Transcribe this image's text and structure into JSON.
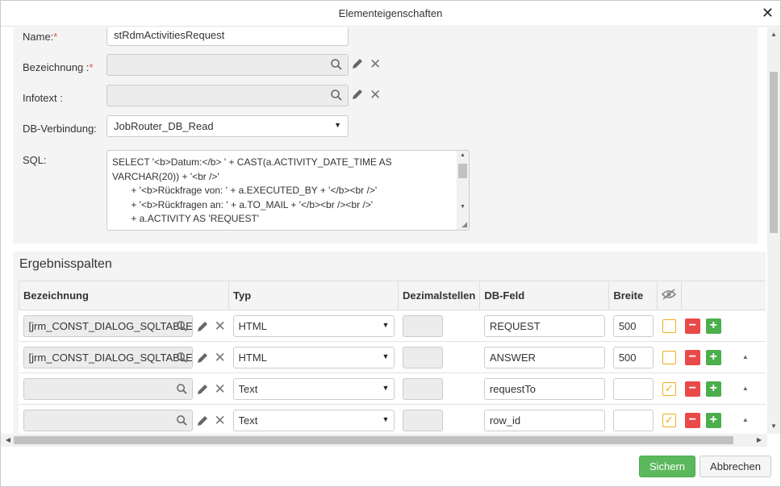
{
  "dialog": {
    "title": "Elementeigenschaften"
  },
  "form": {
    "name": {
      "label": "Name:",
      "value": "stRdmActivitiesRequest"
    },
    "bezeichnung": {
      "label": "Bezeichnung :",
      "value": ""
    },
    "infotext": {
      "label": "Infotext :",
      "value": ""
    },
    "db_verbindung": {
      "label": "DB-Verbindung:",
      "value": "JobRouter_DB_Read"
    },
    "sql": {
      "label": "SQL:",
      "value": "SELECT '<b>Datum:</b> ' + CAST(a.ACTIVITY_DATE_TIME AS VARCHAR(20)) + '<br />'\n       + '<b>Rückfrage von: ' + a.EXECUTED_BY + '</b><br />'\n       + '<b>Rückfragen an: ' + a.TO_MAIL + '</b><br /><br />'\n       + a.ACTIVITY AS 'REQUEST'"
    },
    "required_mark": "*"
  },
  "results": {
    "heading": "Ergebnisspalten",
    "columns": [
      "Bezeichnung",
      "Typ",
      "Dezimalstellen",
      "DB-Feld",
      "Breite"
    ],
    "rows": [
      {
        "bezeichnung": "[jrm_CONST_DIALOG_SQLTABLE",
        "typ": "HTML",
        "db_feld": "REQUEST",
        "breite": "500",
        "hidden": false
      },
      {
        "bezeichnung": "[jrm_CONST_DIALOG_SQLTABLE",
        "typ": "HTML",
        "db_feld": "ANSWER",
        "breite": "500",
        "hidden": false
      },
      {
        "bezeichnung": "",
        "typ": "Text",
        "db_feld": "requestTo",
        "breite": "",
        "hidden": true
      },
      {
        "bezeichnung": "",
        "typ": "Text",
        "db_feld": "row_id",
        "breite": "",
        "hidden": true
      }
    ]
  },
  "footer": {
    "save": "Sichern",
    "cancel": "Abbrechen"
  },
  "colors": {
    "primary": "#5cb85c",
    "danger": "#e94949",
    "add": "#4cae4c",
    "warning": "#f0ad1e"
  }
}
